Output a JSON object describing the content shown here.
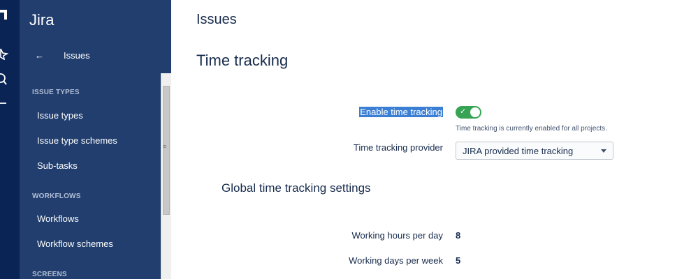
{
  "global_nav": {
    "icons": [
      "jira-logo-icon",
      "star-icon",
      "search-icon",
      "create-icon"
    ]
  },
  "sidebar": {
    "app_title": "Jira",
    "back_label": "Issues",
    "sections": [
      {
        "heading": "ISSUE TYPES",
        "items": [
          "Issue types",
          "Issue type schemes",
          "Sub-tasks"
        ]
      },
      {
        "heading": "WORKFLOWS",
        "items": [
          "Workflows",
          "Workflow schemes"
        ]
      },
      {
        "heading": "SCREENS",
        "items": []
      }
    ]
  },
  "main": {
    "header": "Issues",
    "title": "Time tracking",
    "enable_label": "Enable time tracking",
    "enable_state": true,
    "enable_help": "Time tracking is currently enabled for all projects.",
    "provider_label": "Time tracking provider",
    "provider_value": "JIRA provided time tracking",
    "global_heading": "Global time tracking settings",
    "hours_label": "Working hours per day",
    "hours_value": "8",
    "days_label": "Working days per week",
    "days_value": "5"
  },
  "colors": {
    "global_nav_bg": "#0a2456",
    "sidebar_bg": "#213e6e",
    "toggle_on": "#37a354",
    "selection": "#3b7fd4"
  }
}
